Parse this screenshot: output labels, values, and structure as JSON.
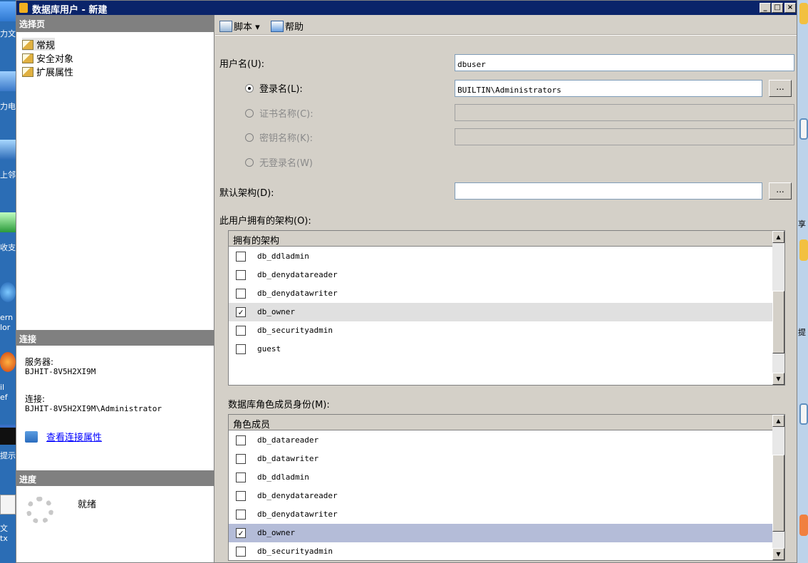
{
  "window": {
    "title": "数据库用户 - 新建",
    "min_btn": "_",
    "max_btn": "□",
    "close_btn": "×"
  },
  "desktop": {
    "left_labels": [
      "力文",
      "力电",
      "上邻",
      "收支",
      "ern",
      "lor",
      "il",
      "ef",
      "提示",
      "文",
      "tx"
    ],
    "right_labels": [
      "享",
      "提"
    ]
  },
  "left": {
    "select_page_title": "选择页",
    "pages": [
      "常规",
      "安全对象",
      "扩展属性"
    ],
    "connection_title": "连接",
    "server_label": "服务器:",
    "server_value": "BJHIT-8V5H2XI9M",
    "connection_label": "连接:",
    "connection_value": "BJHIT-8V5H2XI9M\\Administrator",
    "view_props_link": "查看连接属性",
    "progress_title": "进度",
    "status": "就绪"
  },
  "toolbar": {
    "script_label": "脚本",
    "script_arrow": "▾",
    "help_label": "帮助"
  },
  "form": {
    "username_label": "用户名(U):",
    "username_value": "dbuser",
    "login_name_label": "登录名(L):",
    "login_name_value": "BUILTIN\\Administrators",
    "cert_name_label": "证书名称(C):",
    "key_name_label": "密钥名称(K):",
    "no_login_label": "无登录名(W)",
    "default_schema_label": "默认架构(D):",
    "default_schema_value": "",
    "browse_label": "...",
    "selected_mode": "login"
  },
  "owned_schemas": {
    "label": "此用户拥有的架构(O):",
    "header": "拥有的架构",
    "items": [
      {
        "name": "db_ddladmin",
        "checked": false,
        "mark": ""
      },
      {
        "name": "db_denydatareader",
        "checked": false,
        "mark": ""
      },
      {
        "name": "db_denydatawriter",
        "checked": false,
        "mark": ""
      },
      {
        "name": "db_owner",
        "checked": true,
        "mark": "✓"
      },
      {
        "name": "db_securityadmin",
        "checked": false,
        "mark": ""
      },
      {
        "name": "guest",
        "checked": false,
        "mark": ""
      }
    ]
  },
  "role_membership": {
    "label": "数据库角色成员身份(M):",
    "header": "角色成员",
    "items": [
      {
        "name": "db_datareader",
        "checked": false,
        "mark": ""
      },
      {
        "name": "db_datawriter",
        "checked": false,
        "mark": ""
      },
      {
        "name": "db_ddladmin",
        "checked": false,
        "mark": ""
      },
      {
        "name": "db_denydatareader",
        "checked": false,
        "mark": ""
      },
      {
        "name": "db_denydatawriter",
        "checked": false,
        "mark": ""
      },
      {
        "name": "db_owner",
        "checked": true,
        "mark": "✓"
      },
      {
        "name": "db_securityadmin",
        "checked": false,
        "mark": ""
      }
    ]
  },
  "scroll": {
    "up": "▲",
    "down": "▼"
  },
  "colors": {
    "titlebar": "#0a246a",
    "section_header": "#808080",
    "selected_row": "#b4bcd8",
    "link": "#0000ff"
  }
}
